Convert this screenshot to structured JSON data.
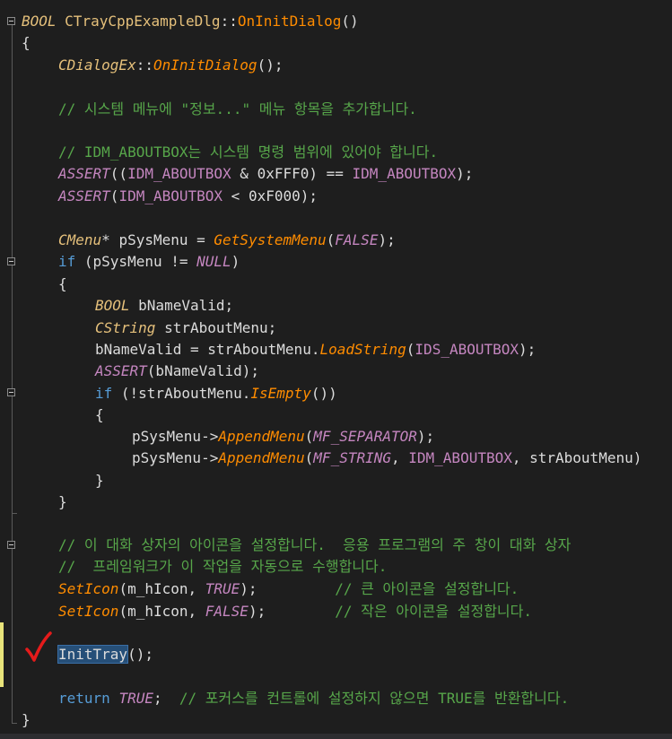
{
  "code": {
    "l1_bool": "BOOL",
    "l1_class": "CTrayCppExampleDlg",
    "l1_sep": "::",
    "l1_fn": "OnInitDialog",
    "l1_tail": "()",
    "l2": "{",
    "l3_class": "CDialogEx",
    "l3_sep": "::",
    "l3_fn": "OnInitDialog",
    "l3_tail": "();",
    "l4_comment": "// 시스템 메뉴에 \"정보...\" 메뉴 항목을 추가합니다.",
    "l5_comment": "// IDM_ABOUTBOX는 시스템 명령 범위에 있어야 합니다.",
    "l6_assert": "ASSERT",
    "l6_a": "((",
    "l6_id": "IDM_ABOUTBOX",
    "l6_b": " & ",
    "l6_num": "0xFFF0",
    "l6_c": ") == ",
    "l6_id2": "IDM_ABOUTBOX",
    "l6_d": ");",
    "l7_assert": "ASSERT",
    "l7_a": "(",
    "l7_id": "IDM_ABOUTBOX",
    "l7_b": " < ",
    "l7_num": "0xF000",
    "l7_c": ");",
    "l8_type": "CMenu",
    "l8_a": "* pSysMenu = ",
    "l8_fn": "GetSystemMenu",
    "l8_b": "(",
    "l8_const": "FALSE",
    "l8_c": ");",
    "l9_kw": "if",
    "l9_a": " (pSysMenu != ",
    "l9_const": "NULL",
    "l9_b": ")",
    "l10": "{",
    "l11_type": "BOOL",
    "l11_a": " bNameValid;",
    "l12_type": "CString",
    "l12_a": " strAboutMenu;",
    "l13_a": "bNameValid = strAboutMenu.",
    "l13_fn": "LoadString",
    "l13_b": "(",
    "l13_id": "IDS_ABOUTBOX",
    "l13_c": ");",
    "l14_assert": "ASSERT",
    "l14_a": "(bNameValid);",
    "l15_kw": "if",
    "l15_a": " (!strAboutMenu.",
    "l15_fn": "IsEmpty",
    "l15_b": "())",
    "l16": "{",
    "l17_a": "pSysMenu->",
    "l17_fn": "AppendMenu",
    "l17_b": "(",
    "l17_const": "MF_SEPARATOR",
    "l17_c": ");",
    "l18_a": "pSysMenu->",
    "l18_fn": "AppendMenu",
    "l18_b": "(",
    "l18_const": "MF_STRING",
    "l18_c": ", ",
    "l18_id": "IDM_ABOUTBOX",
    "l18_d": ", strAboutMenu)",
    "l19": "}",
    "l20": "}",
    "l21_comment": "// 이 대화 상자의 아이콘을 설정합니다.  응용 프로그램의 주 창이 대화 상자",
    "l22_comment": "//  프레임워크가 이 작업을 자동으로 수행합니다.",
    "l23_fn": "SetIcon",
    "l23_a": "(m_hIcon, ",
    "l23_const": "TRUE",
    "l23_b": ");         ",
    "l23_comment": "// 큰 아이콘을 설정합니다.",
    "l24_fn": "SetIcon",
    "l24_a": "(m_hIcon, ",
    "l24_const": "FALSE",
    "l24_b": ");        ",
    "l24_comment": "// 작은 아이콘을 설정합니다.",
    "l25_sel": "InitTray",
    "l25_a": "();",
    "l26_kw": "return",
    "l26_sp": " ",
    "l26_const": "TRUE",
    "l26_a": ";  ",
    "l26_comment": "// 포커스를 컨트롤에 설정하지 않으면 TRUE를 반환합니다.",
    "l27": "}"
  }
}
